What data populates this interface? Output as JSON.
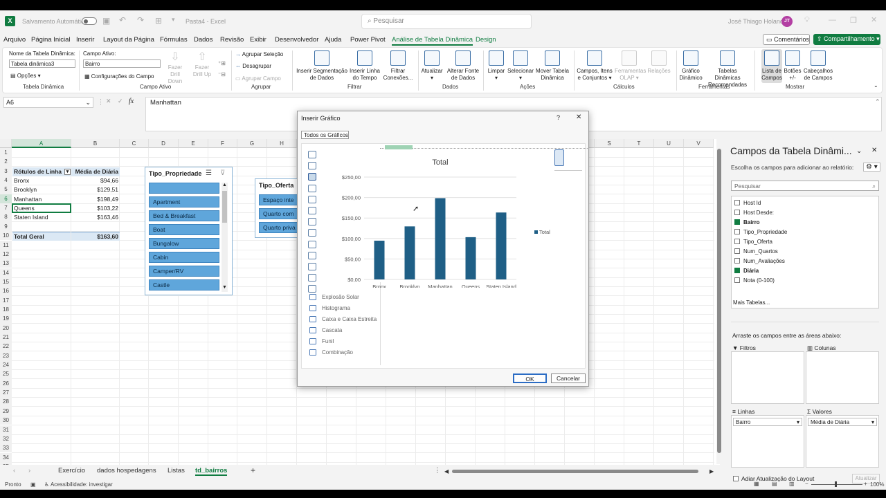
{
  "titlebar": {
    "autosave_label": "Salvamento Automático",
    "filename": "Pasta4 - Excel",
    "search_placeholder": "Pesquisar",
    "user_name": "José Thiago Holanda",
    "user_initials": "JT"
  },
  "menu": {
    "items": [
      "Arquivo",
      "Página Inicial",
      "Inserir",
      "Layout da Página",
      "Fórmulas",
      "Dados",
      "Revisão",
      "Exibir",
      "Desenvolvedor",
      "Ajuda",
      "Power Pivot",
      "Análise de Tabela Dinâmica",
      "Design"
    ],
    "comments_label": "Comentários",
    "share_label": "Compartilhamento"
  },
  "ribbon": {
    "pivot_name_label": "Nome da Tabela Dinâmica:",
    "pivot_name_value": "Tabela dinâmica3",
    "options_label": "Opções",
    "group_tabela": "Tabela Dinâmica",
    "active_field_label": "Campo Ativo:",
    "active_field_value": "Bairro",
    "field_settings_label": "Configurações do Campo",
    "drill_down_label": "Fazer Drill Down",
    "drill_up_label": "Fazer Drill Up",
    "group_campo": "Campo Ativo",
    "group_selection": "Agrupar Seleção",
    "ungroup": "Desagrupar",
    "group_field": "Agrupar Campo",
    "group_agrupar": "Agrupar",
    "insert_slicer": "Inserir Segmentação de Dados",
    "insert_timeline": "Inserir Linha do Tempo",
    "filter_connections": "Filtrar Conexões...",
    "group_filtrar": "Filtrar",
    "refresh": "Atualizar",
    "change_source": "Alterar Fonte de Dados",
    "group_dados": "Dados",
    "clear": "Limpar",
    "select": "Selecionar",
    "move_pivot": "Mover Tabela Dinâmica",
    "group_acoes": "Ações",
    "fields_items": "Campos, Itens e Conjuntos",
    "olap_tools": "Ferramentas OLAP",
    "relationships": "Relações",
    "group_calculos": "Cálculos",
    "pivot_chart": "Gráfico Dinâmico",
    "recommended": "Tabelas Dinâmicas Recomendadas",
    "group_ferramentas": "Ferramentas",
    "field_list": "Lista de Campos",
    "buttons": "Botões +/-",
    "field_headers": "Cabeçalhos de Campos",
    "group_mostrar": "Mostrar"
  },
  "formula_bar": {
    "name_box": "A6",
    "fx": "fx",
    "content": "Manhattan"
  },
  "sheet": {
    "columns": [
      "A",
      "B",
      "C",
      "D",
      "E",
      "F",
      "G",
      "H",
      "I",
      "J",
      "K",
      "L",
      "M",
      "N",
      "O",
      "P",
      "Q",
      "R",
      "S",
      "T",
      "U",
      "V"
    ],
    "rows": [
      "1",
      "2",
      "3",
      "4",
      "5",
      "6",
      "7",
      "8",
      "9",
      "10",
      "11",
      "12",
      "13",
      "14",
      "15",
      "16",
      "17",
      "18",
      "19",
      "20",
      "21",
      "22",
      "23",
      "24",
      "25",
      "26",
      "27",
      "28",
      "29",
      "30",
      "31",
      "32",
      "33",
      "34",
      "35"
    ],
    "pivot_header": [
      "Rótulos de Linha",
      "Média de Diária"
    ],
    "pivot_rows": [
      {
        "label": "Bronx",
        "value": "$94,66"
      },
      {
        "label": "Brooklyn",
        "value": "$129,51"
      },
      {
        "label": "Manhattan",
        "value": "$198,49"
      },
      {
        "label": "Queens",
        "value": "$103,22"
      },
      {
        "label": "Staten Island",
        "value": "$163,46"
      }
    ],
    "pivot_total": {
      "label": "Total Geral",
      "value": "$163,60"
    }
  },
  "slicer_tipo": {
    "title": "Tipo_Propriedade",
    "items": [
      "",
      "Apartment",
      "Bed & Breakfast",
      "Boat",
      "Bungalow",
      "Cabin",
      "Camper/RV",
      "Castle"
    ]
  },
  "slicer_oferta": {
    "title": "Tipo_Oferta",
    "items": [
      "Espaço inte",
      "Quarto com",
      "Quarto priva"
    ]
  },
  "dialog": {
    "title": "Inserir Gráfico",
    "help": "?",
    "close": "✕",
    "tab": "Todos os Gráficos",
    "chart_types": [
      "Explosão Solar",
      "Histograma",
      "Caixa e Caixa Estreita",
      "Cascata",
      "Funil",
      "Combinação"
    ],
    "ok": "OK",
    "cancel": "Cancelar"
  },
  "chart_data": {
    "type": "bar",
    "title": "Total",
    "categories": [
      "Bronx",
      "Brooklyn",
      "Manhattan",
      "Queens",
      "Staten Island"
    ],
    "series": [
      {
        "name": "Total",
        "values": [
          94.66,
          129.51,
          198.49,
          103.22,
          163.46
        ]
      }
    ],
    "yticks": [
      "$0,00",
      "$50,00",
      "$100,00",
      "$150,00",
      "$200,00",
      "$250,00"
    ],
    "ylim": [
      0,
      250
    ],
    "legend_position": "right",
    "bar_color": "#1f5f86"
  },
  "panel": {
    "title": "Campos da Tabela Dinâmi...",
    "subtitle": "Escolha os campos para adicionar ao relatório:",
    "search_placeholder": "Pesquisar",
    "fields": [
      {
        "name": "Host Id",
        "checked": false
      },
      {
        "name": "Host Desde:",
        "checked": false
      },
      {
        "name": "Bairro",
        "checked": true
      },
      {
        "name": "Tipo_Propriedade",
        "checked": false
      },
      {
        "name": "Tipo_Oferta",
        "checked": false
      },
      {
        "name": "Num_Quartos",
        "checked": false
      },
      {
        "name": "Num_Avaliações",
        "checked": false
      },
      {
        "name": "Diária",
        "checked": true
      },
      {
        "name": "Nota (0-100)",
        "checked": false
      }
    ],
    "more_tables": "Mais Tabelas...",
    "drag_hint": "Arraste os campos entre as áreas abaixo:",
    "filters": "Filtros",
    "columns": "Colunas",
    "rows": "Linhas",
    "values": "Valores",
    "rows_item": "Bairro",
    "values_item": "Média de Diária",
    "defer_label": "Adiar Atualização do Layout",
    "update": "Atualizar"
  },
  "tabs": {
    "items": [
      "Exercício",
      "dados hospedagens",
      "Listas",
      "td_bairros"
    ],
    "active": "td_bairros"
  },
  "status": {
    "ready": "Pronto",
    "accessibility": "Acessibilidade: investigar",
    "zoom": "100%"
  }
}
